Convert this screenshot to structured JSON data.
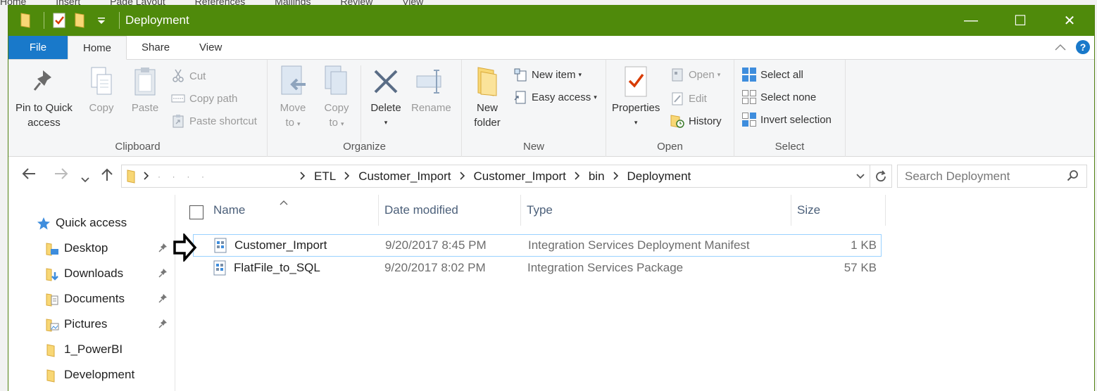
{
  "window": {
    "title": "Deployment"
  },
  "behind_menu": [
    "Home",
    "Insert",
    "Page Layout",
    "References",
    "Mailings",
    "Review",
    "View"
  ],
  "title_controls": {
    "minimize": "—",
    "maximize": "☐",
    "close": "✕"
  },
  "ribbon_tabs": {
    "file": "File",
    "home": "Home",
    "share": "Share",
    "view": "View"
  },
  "ribbon": {
    "clipboard": {
      "label": "Clipboard",
      "pin": "Pin to Quick access",
      "pin_line1": "Pin to Quick",
      "pin_line2": "access",
      "copy": "Copy",
      "paste": "Paste",
      "cut": "Cut",
      "copy_path": "Copy path",
      "paste_shortcut": "Paste shortcut"
    },
    "organize": {
      "label": "Organize",
      "move_line1": "Move",
      "move_line2": "to",
      "copy_line1": "Copy",
      "copy_line2": "to",
      "delete": "Delete",
      "rename": "Rename"
    },
    "new": {
      "label": "New",
      "folder_line1": "New",
      "folder_line2": "folder",
      "new_item": "New item",
      "easy_access": "Easy access"
    },
    "open": {
      "label": "Open",
      "properties": "Properties",
      "open": "Open",
      "edit": "Edit",
      "history": "History"
    },
    "select": {
      "label": "Select",
      "select_all": "Select all",
      "select_none": "Select none",
      "invert": "Invert selection"
    }
  },
  "address": {
    "crumbs": [
      "ETL",
      "Customer_Import",
      "Customer_Import",
      "bin",
      "Deployment"
    ],
    "redacted": "·     ·     ·     ·"
  },
  "search": {
    "placeholder": "Search Deployment"
  },
  "nav_pane": {
    "quick_access": "Quick access",
    "items": [
      {
        "label": "Desktop",
        "pinned": true
      },
      {
        "label": "Downloads",
        "pinned": true
      },
      {
        "label": "Documents",
        "pinned": true
      },
      {
        "label": "Pictures",
        "pinned": true
      },
      {
        "label": "1_PowerBI",
        "pinned": false
      },
      {
        "label": "Development",
        "pinned": false
      }
    ]
  },
  "columns": {
    "name": "Name",
    "date": "Date modified",
    "type": "Type",
    "size": "Size"
  },
  "files": [
    {
      "name": "Customer_Import",
      "date": "9/20/2017 8:45 PM",
      "type": "Integration Services Deployment Manifest",
      "size": "1 KB",
      "selected": true
    },
    {
      "name": "FlatFile_to_SQL",
      "date": "9/20/2017 8:02 PM",
      "type": "Integration Services Package",
      "size": "57 KB",
      "selected": false
    }
  ],
  "colors": {
    "titlebar": "#4f8a0b",
    "file_tab": "#1979ca",
    "folder": "#f8d775",
    "selection_border": "#99d1ff"
  }
}
